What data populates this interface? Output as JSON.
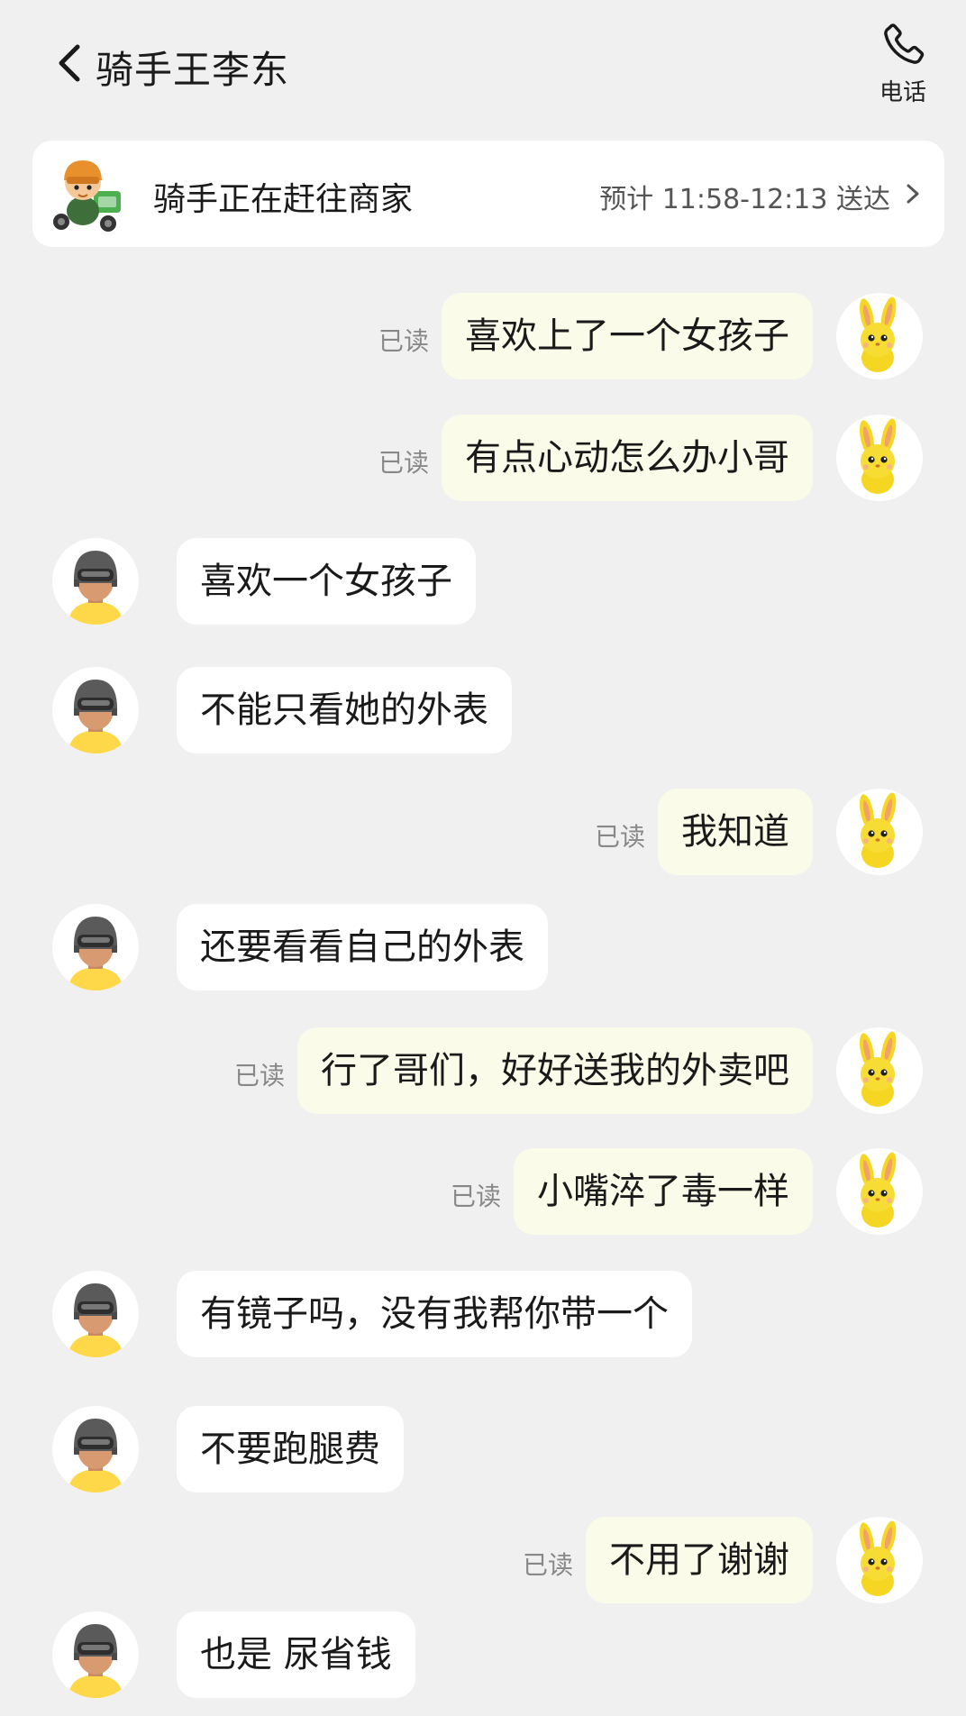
{
  "header": {
    "title": "骑手王李东",
    "phone_label": "电话"
  },
  "status": {
    "text": "骑手正在赶往商家",
    "eta": "预计 11:58-12:13 送达"
  },
  "messages": [
    {
      "side": "out",
      "text": "喜欢上了一个女孩子",
      "read": "已读"
    },
    {
      "side": "out",
      "text": "有点心动怎么办小哥",
      "read": "已读"
    },
    {
      "side": "in",
      "text": "喜欢一个女孩子"
    },
    {
      "side": "in",
      "text": "不能只看她的外表"
    },
    {
      "side": "out",
      "text": "我知道",
      "read": "已读"
    },
    {
      "side": "in",
      "text": "还要看看自己的外表"
    },
    {
      "side": "out",
      "text": "行了哥们，好好送我的外卖吧",
      "read": "已读"
    },
    {
      "side": "out",
      "text": "小嘴淬了毒一样",
      "read": "已读"
    },
    {
      "side": "in",
      "text": "有镜子吗，没有我帮你带一个"
    },
    {
      "side": "in",
      "text": "不要跑腿费"
    },
    {
      "side": "out",
      "text": "不用了谢谢",
      "read": "已读"
    },
    {
      "side": "in",
      "text": "也是 尿省钱"
    }
  ],
  "colors": {
    "background": "#f0f0f0",
    "outgoing_bubble": "#fbfbe9",
    "incoming_bubble": "#ffffff",
    "read_text": "#888888",
    "bunny_yellow": "#f5d623"
  },
  "icons": {
    "back": "chevron-left-icon",
    "phone": "phone-icon",
    "eta_arrow": "chevron-right-icon",
    "rider_illustration": "rider-illustration-icon",
    "user_avatar": "yellow-bunny-avatar",
    "rider_avatar": "helmet-rider-avatar"
  }
}
